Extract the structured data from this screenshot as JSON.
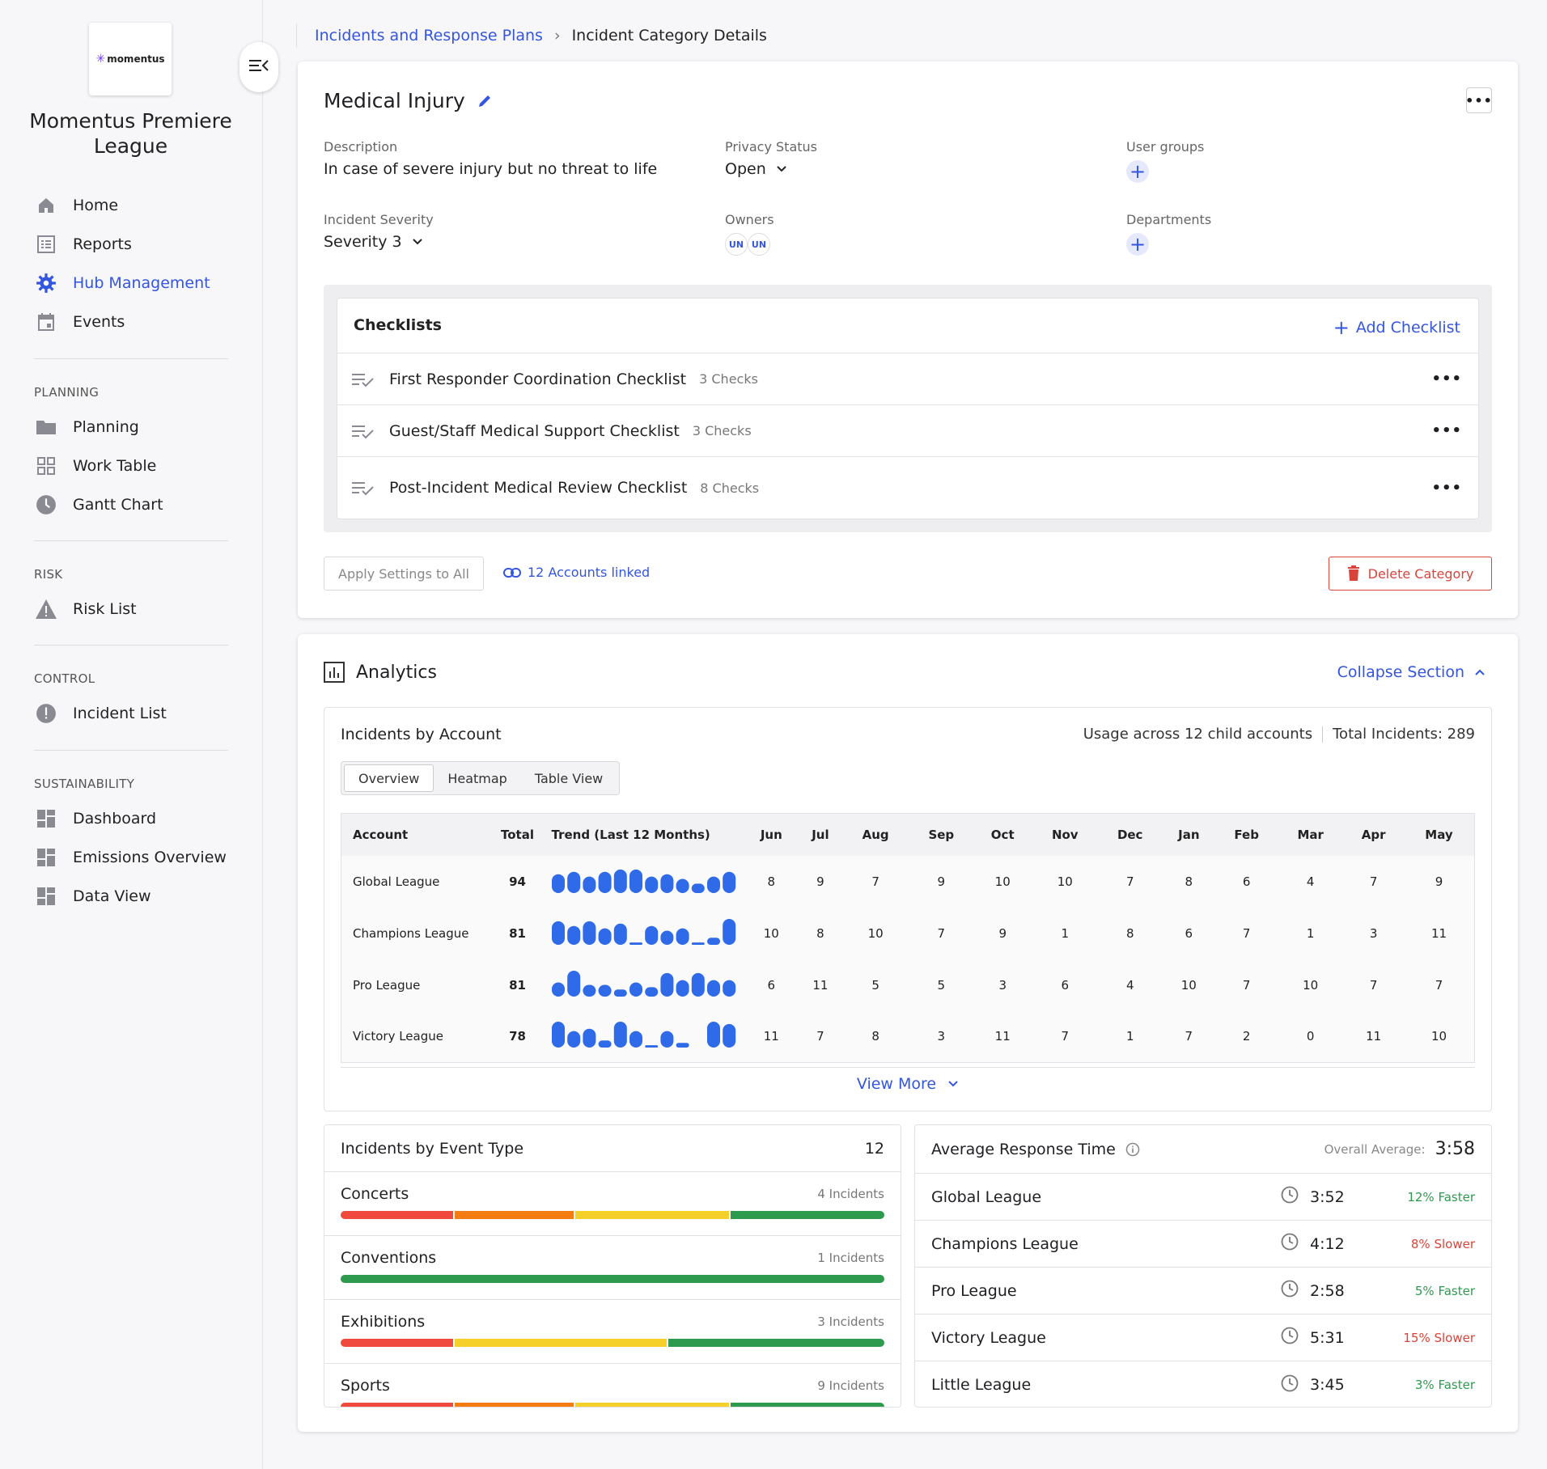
{
  "sidebar": {
    "logo_text": "momentus",
    "org_name": "Momentus Premiere League",
    "nav": [
      {
        "label": "Home",
        "icon": "home-icon"
      },
      {
        "label": "Reports",
        "icon": "reports-icon"
      },
      {
        "label": "Hub Management",
        "icon": "gear-icon",
        "active": true
      },
      {
        "label": "Events",
        "icon": "calendar-icon"
      }
    ],
    "sections": [
      {
        "title": "PLANNING",
        "items": [
          {
            "label": "Planning",
            "icon": "folder-icon"
          },
          {
            "label": "Work Table",
            "icon": "grid-icon"
          },
          {
            "label": "Gantt Chart",
            "icon": "clock-icon"
          }
        ]
      },
      {
        "title": "RISK",
        "items": [
          {
            "label": "Risk List",
            "icon": "warning-icon"
          }
        ]
      },
      {
        "title": "CONTROL",
        "items": [
          {
            "label": "Incident List",
            "icon": "alert-circle-icon"
          }
        ]
      },
      {
        "title": "SUSTAINABILITY",
        "items": [
          {
            "label": "Dashboard",
            "icon": "dashboard-icon"
          },
          {
            "label": "Emissions Overview",
            "icon": "dashboard-icon"
          },
          {
            "label": "Data View",
            "icon": "dashboard-icon"
          }
        ]
      }
    ]
  },
  "breadcrumb": {
    "parent": "Incidents and Response Plans",
    "current": "Incident Category Details"
  },
  "category": {
    "title": "Medical Injury",
    "description_label": "Description",
    "description": "In case of severe injury but no threat to life",
    "privacy_label": "Privacy Status",
    "privacy": "Open",
    "user_groups_label": "User groups",
    "severity_label": "Incident Severity",
    "severity": "Severity 3",
    "owners_label": "Owners",
    "owners": [
      "UN",
      "UN"
    ],
    "departments_label": "Departments"
  },
  "checklists": {
    "title": "Checklists",
    "add_label": "Add Checklist",
    "items": [
      {
        "name": "First Responder Coordination Checklist",
        "checks": "3 Checks"
      },
      {
        "name": "Guest/Staff Medical Support Checklist",
        "checks": "3 Checks"
      },
      {
        "name": "Post-Incident Medical Review Checklist",
        "checks": "8 Checks"
      }
    ]
  },
  "actions": {
    "apply": "Apply Settings to All",
    "linked": "12 Accounts linked",
    "delete": "Delete Category"
  },
  "analytics": {
    "title": "Analytics",
    "collapse_label": "Collapse Section",
    "by_account": {
      "title": "Incidents by Account",
      "usage": "Usage across 12 child accounts",
      "total": "Total Incidents: 289",
      "tabs": [
        "Overview",
        "Heatmap",
        "Table View"
      ],
      "columns": [
        "Account",
        "Total",
        "Trend (Last 12 Months)",
        "Jun",
        "Jul",
        "Aug",
        "Sep",
        "Oct",
        "Nov",
        "Dec",
        "Jan",
        "Feb",
        "Mar",
        "Apr",
        "May"
      ],
      "rows": [
        {
          "account": "Global League",
          "total": "94",
          "months": [
            8,
            9,
            7,
            9,
            10,
            10,
            7,
            8,
            6,
            4,
            7,
            9
          ]
        },
        {
          "account": "Champions League",
          "total": "81",
          "months": [
            10,
            8,
            10,
            7,
            9,
            1,
            8,
            6,
            7,
            1,
            3,
            11
          ]
        },
        {
          "account": "Pro League",
          "total": "81",
          "months": [
            6,
            11,
            5,
            5,
            3,
            6,
            4,
            10,
            7,
            10,
            7,
            7
          ]
        },
        {
          "account": "Victory League",
          "total": "78",
          "months": [
            11,
            7,
            8,
            3,
            11,
            7,
            1,
            7,
            2,
            0,
            11,
            10
          ]
        }
      ],
      "view_more": "View More"
    },
    "by_event_type": {
      "title": "Incidents by Event Type",
      "count": "12",
      "rows": [
        {
          "name": "Concerts",
          "count": "4 Incidents",
          "segments": [
            {
              "pct": 20.8,
              "color": "#f04a3e"
            },
            {
              "pct": 22.2,
              "color": "#f57c12"
            },
            {
              "pct": 28.5,
              "color": "#f5cf2a"
            },
            {
              "pct": 28.5,
              "color": "#2e9a4e"
            }
          ]
        },
        {
          "name": "Conventions",
          "count": "1 Incidents",
          "segments": [
            {
              "pct": 100,
              "color": "#2e9a4e"
            }
          ]
        },
        {
          "name": "Exhibitions",
          "count": "3 Incidents",
          "segments": [
            {
              "pct": 20.8,
              "color": "#f04a3e"
            },
            {
              "pct": 39.3,
              "color": "#f5cf2a"
            },
            {
              "pct": 39.9,
              "color": "#2e9a4e"
            }
          ]
        },
        {
          "name": "Sports",
          "count": "9 Incidents",
          "segments": [
            {
              "pct": 20.8,
              "color": "#f04a3e"
            },
            {
              "pct": 22.2,
              "color": "#f57c12"
            },
            {
              "pct": 28.5,
              "color": "#f5cf2a"
            },
            {
              "pct": 28.5,
              "color": "#2e9a4e"
            }
          ]
        }
      ]
    },
    "response_time": {
      "title": "Average Response Time",
      "overall_label": "Overall Average:",
      "overall": "3:58",
      "rows": [
        {
          "name": "Global League",
          "time": "3:52",
          "delta": "12% Faster",
          "color": "#2e9a4e"
        },
        {
          "name": "Champions League",
          "time": "4:12",
          "delta": "8% Slower",
          "color": "#d9443a"
        },
        {
          "name": "Pro League",
          "time": "2:58",
          "delta": "5% Faster",
          "color": "#2e9a4e"
        },
        {
          "name": "Victory League",
          "time": "5:31",
          "delta": "15% Slower",
          "color": "#d9443a"
        },
        {
          "name": "Little League",
          "time": "3:45",
          "delta": "3% Faster",
          "color": "#2e9a4e"
        }
      ]
    }
  },
  "colors": {
    "accent": "#3355e0",
    "danger": "#d9443a",
    "spark": "#2f6ae8"
  }
}
